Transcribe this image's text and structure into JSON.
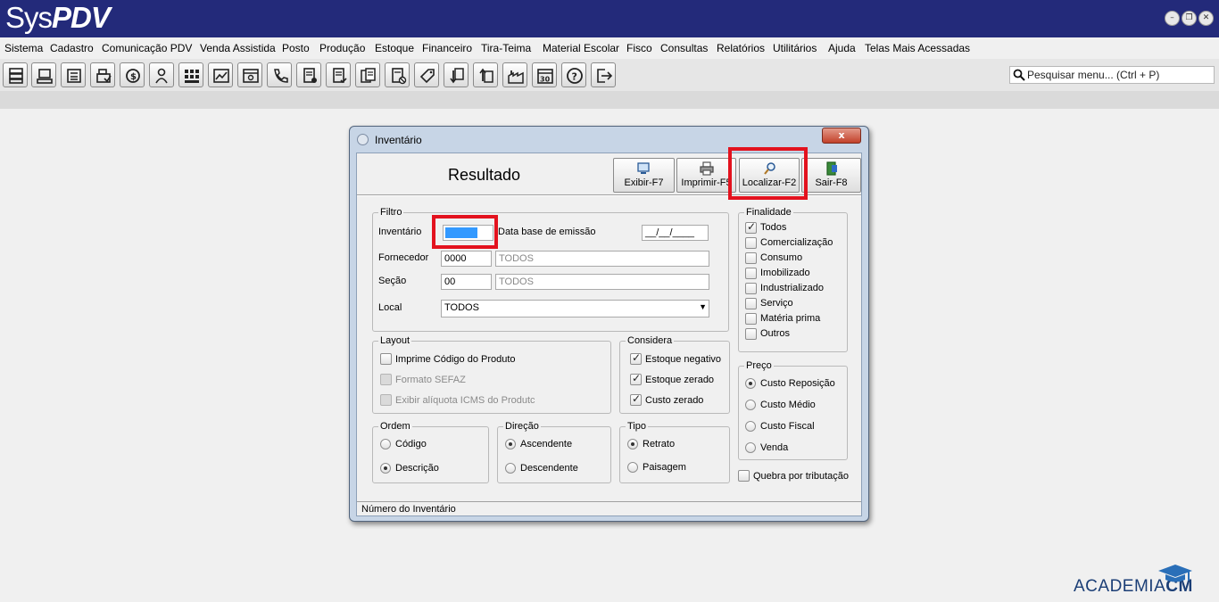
{
  "app": {
    "logo_sys": "Sys",
    "logo_pdv": "PDV",
    "window_controls": [
      "minimize-icon",
      "restore-icon",
      "close-icon"
    ]
  },
  "menu": [
    "Sistema",
    "Cadastro",
    "Comunicação PDV",
    "Venda Assistida",
    "Posto",
    "Produção",
    "Estoque",
    "Financeiro",
    "Tira-Teima",
    "Material Escolar",
    "Fisco",
    "Consultas",
    "Relatórios",
    "Utilitários",
    "Ajuda",
    "Telas Mais Acessadas"
  ],
  "toolbar": {
    "icons": [
      "server-icon",
      "pos-terminal-icon",
      "register-icon",
      "cash-register-icon",
      "currency-icon",
      "users-icon",
      "grid-icon",
      "chart-icon",
      "browser-icon",
      "phone-icon",
      "document-icon",
      "document-check-icon",
      "documents-icon",
      "document-cancel-icon",
      "tag-icon",
      "import-icon",
      "export-icon",
      "factory-icon",
      "calendar-icon",
      "help-icon",
      "exit-icon"
    ],
    "calendar_day": "30",
    "search_placeholder": "Pesquisar menu... (Ctrl + P)"
  },
  "dialog": {
    "title": "Inventário",
    "close_label": "x",
    "heading": "Resultado",
    "buttons": {
      "exibir": "Exibir-F7",
      "imprimir": "Imprimir-F5",
      "localizar": "Localizar-F2",
      "sair": "Sair-F8"
    },
    "filtro": {
      "title": "Filtro",
      "inventario_label": "Inventário",
      "inventario_value": "",
      "data_label": "Data base de emissão",
      "data_value": "__/__/____",
      "fornecedor_label": "Fornecedor",
      "fornecedor_code": "0000",
      "fornecedor_name": "TODOS",
      "secao_label": "Seção",
      "secao_code": "00",
      "secao_name": "TODOS",
      "local_label": "Local",
      "local_value": "TODOS"
    },
    "finalidade": {
      "title": "Finalidade",
      "items": [
        {
          "label": "Todos",
          "checked": true
        },
        {
          "label": "Comercialização",
          "checked": false
        },
        {
          "label": "Consumo",
          "checked": false
        },
        {
          "label": "Imobilizado",
          "checked": false
        },
        {
          "label": "Industrializado",
          "checked": false
        },
        {
          "label": "Serviço",
          "checked": false
        },
        {
          "label": "Matéria prima",
          "checked": false
        },
        {
          "label": "Outros",
          "checked": false
        }
      ]
    },
    "layout": {
      "title": "Layout",
      "items": [
        {
          "label": "Imprime Código do Produto",
          "checked": false,
          "enabled": true
        },
        {
          "label": "Formato SEFAZ",
          "checked": false,
          "enabled": false
        },
        {
          "label": "Exibir alíquota ICMS do Produtc",
          "checked": false,
          "enabled": false
        }
      ]
    },
    "considera": {
      "title": "Considera",
      "items": [
        {
          "label": "Estoque negativo",
          "checked": true
        },
        {
          "label": "Estoque zerado",
          "checked": true
        },
        {
          "label": "Custo zerado",
          "checked": true
        }
      ]
    },
    "preco": {
      "title": "Preço",
      "items": [
        {
          "label": "Custo Reposição",
          "selected": true
        },
        {
          "label": "Custo Médio",
          "selected": false
        },
        {
          "label": "Custo Fiscal",
          "selected": false
        },
        {
          "label": "Venda",
          "selected": false
        }
      ]
    },
    "ordem": {
      "title": "Ordem",
      "items": [
        {
          "label": "Código",
          "selected": false
        },
        {
          "label": "Descrição",
          "selected": true
        }
      ]
    },
    "direcao": {
      "title": "Direção",
      "items": [
        {
          "label": "Ascendente",
          "selected": true
        },
        {
          "label": "Descendente",
          "selected": false
        }
      ]
    },
    "tipo": {
      "title": "Tipo",
      "items": [
        {
          "label": "Retrato",
          "selected": true
        },
        {
          "label": "Paisagem",
          "selected": false
        }
      ]
    },
    "quebra": {
      "label": "Quebra por tributação",
      "checked": false
    },
    "status": "Número do Inventário"
  },
  "watermark": {
    "text1": "ACADEMIA",
    "text2": "CM"
  },
  "colors": {
    "titlebar": "#232a7a",
    "highlight": "#e3121e",
    "selection": "#3399ff"
  }
}
